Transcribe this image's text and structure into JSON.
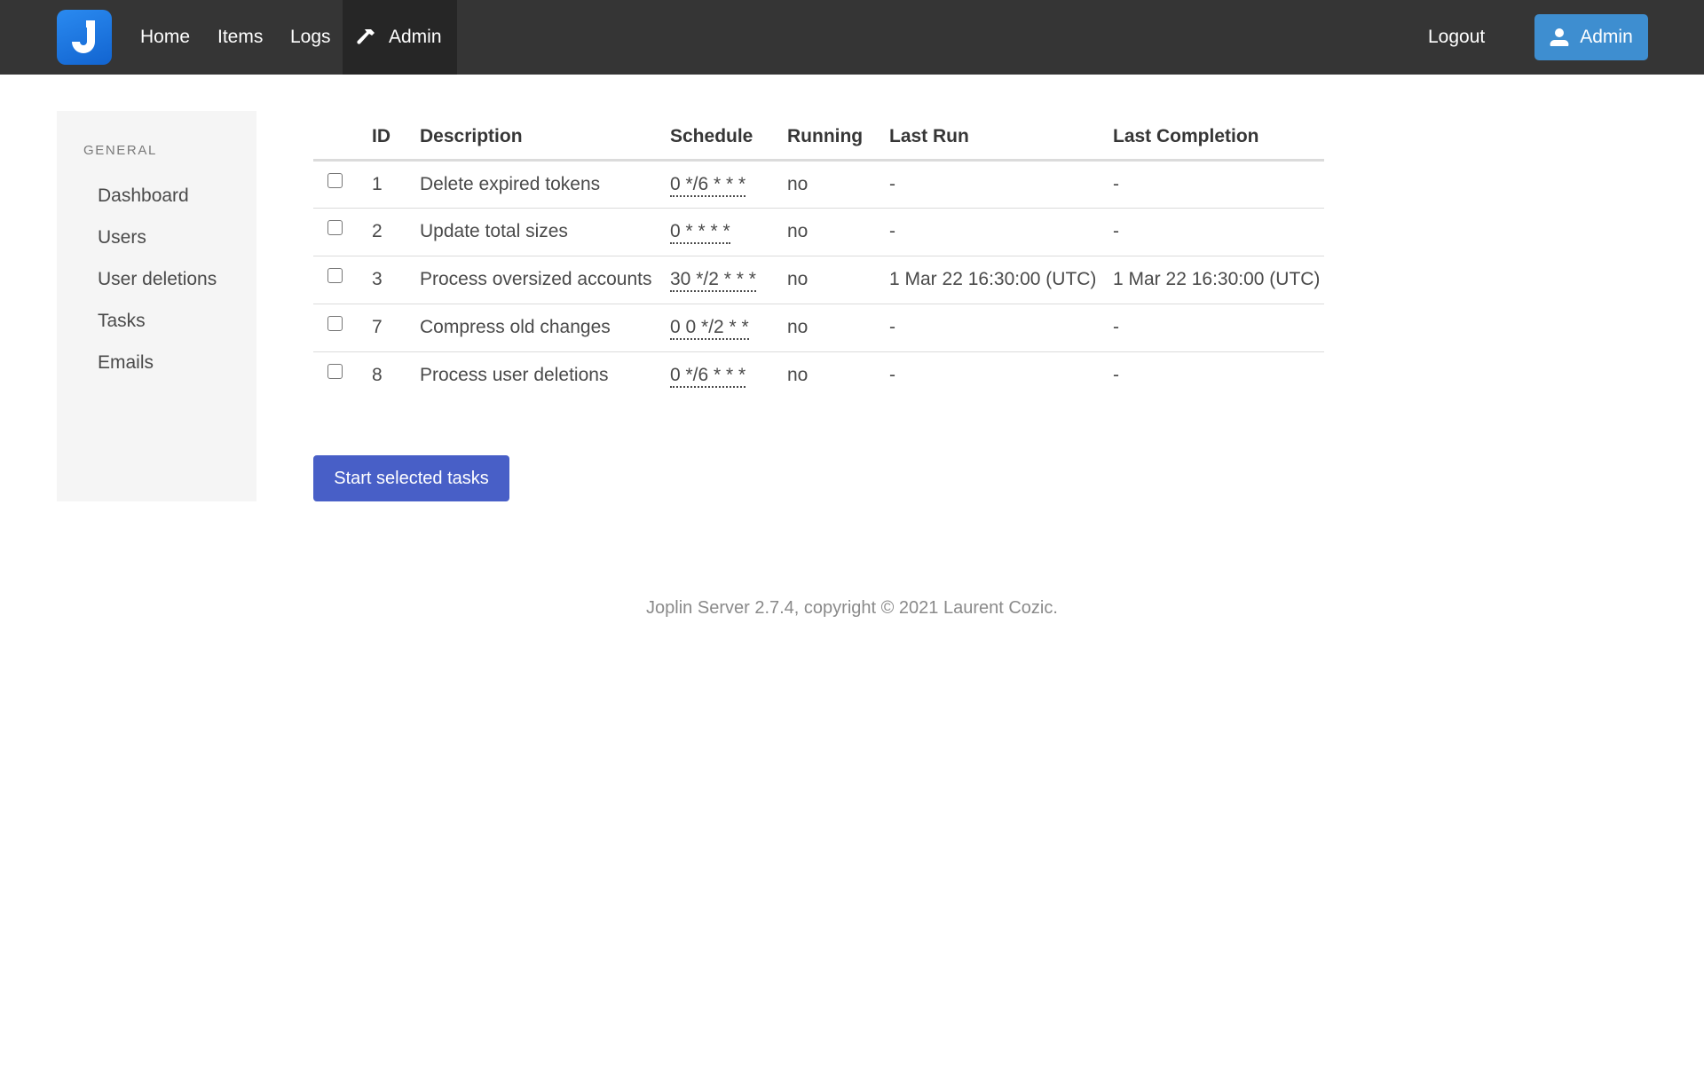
{
  "navbar": {
    "logo_letter": "J",
    "items": [
      {
        "label": "Home",
        "active": false
      },
      {
        "label": "Items",
        "active": false
      },
      {
        "label": "Logs",
        "active": false
      },
      {
        "label": "Admin",
        "active": true,
        "icon": "hammer-icon"
      }
    ],
    "logout_label": "Logout",
    "user_button_label": "Admin",
    "user_button_icon": "user-icon",
    "colors": {
      "bar": "#353535",
      "active": "#262626",
      "user_button": "#3e8ed0",
      "logo": "#1a73e8"
    }
  },
  "sidebar": {
    "section_label": "GENERAL",
    "items": [
      {
        "label": "Dashboard"
      },
      {
        "label": "Users"
      },
      {
        "label": "User deletions"
      },
      {
        "label": "Tasks"
      },
      {
        "label": "Emails"
      }
    ]
  },
  "tasks_table": {
    "columns": [
      "",
      "ID",
      "Description",
      "Schedule",
      "Running",
      "Last Run",
      "Last Completion"
    ],
    "rows": [
      {
        "checked": false,
        "id": "1",
        "description": "Delete expired tokens",
        "schedule": "0 */6 * * *",
        "running": "no",
        "last_run": "-",
        "last_completion": "-"
      },
      {
        "checked": false,
        "id": "2",
        "description": "Update total sizes",
        "schedule": "0 * * * *",
        "running": "no",
        "last_run": "-",
        "last_completion": "-"
      },
      {
        "checked": false,
        "id": "3",
        "description": "Process oversized accounts",
        "schedule": "30 */2 * * *",
        "running": "no",
        "last_run": "1 Mar 22 16:30:00 (UTC)",
        "last_completion": "1 Mar 22 16:30:00 (UTC)"
      },
      {
        "checked": false,
        "id": "7",
        "description": "Compress old changes",
        "schedule": "0 0 */2 * *",
        "running": "no",
        "last_run": "-",
        "last_completion": "-"
      },
      {
        "checked": false,
        "id": "8",
        "description": "Process user deletions",
        "schedule": "0 */6 * * *",
        "running": "no",
        "last_run": "-",
        "last_completion": "-"
      }
    ]
  },
  "actions": {
    "start_button_label": "Start selected tasks",
    "start_button_color": "#485fc7"
  },
  "footer": {
    "text": "Joplin Server 2.7.4, copyright © 2021 Laurent Cozic."
  }
}
